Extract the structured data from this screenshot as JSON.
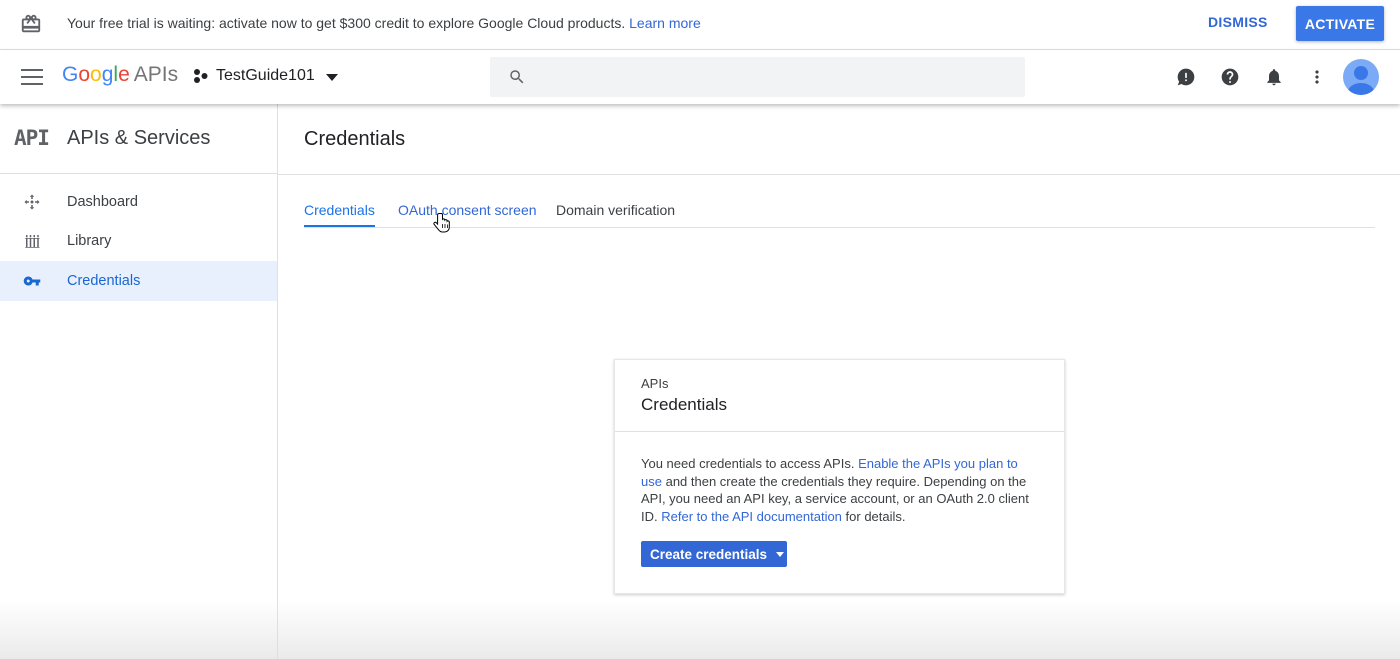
{
  "banner": {
    "message": "Your free trial is waiting: activate now to get $300 credit to explore Google Cloud products.",
    "learn_more": "Learn more",
    "dismiss": "DISMISS",
    "activate": "ACTIVATE",
    "icon": "gift-icon"
  },
  "appbar": {
    "logo_letters": [
      "G",
      "o",
      "o",
      "g",
      "l",
      "e"
    ],
    "logo_suffix": "APIs",
    "project_name": "TestGuide101",
    "search_placeholder": "",
    "icons": [
      "feedback-icon",
      "help-icon",
      "notifications-icon",
      "more-vert-icon"
    ]
  },
  "sidenav": {
    "mark": "API",
    "title": "APIs & Services",
    "items": [
      {
        "label": "Dashboard",
        "icon": "dashboard-icon",
        "active": false
      },
      {
        "label": "Library",
        "icon": "library-icon",
        "active": false
      },
      {
        "label": "Credentials",
        "icon": "key-icon",
        "active": true
      }
    ]
  },
  "main": {
    "title": "Credentials",
    "tabs": [
      {
        "label": "Credentials",
        "active": true
      },
      {
        "label": "OAuth consent screen",
        "active": false
      },
      {
        "label": "Domain verification",
        "active": false
      }
    ]
  },
  "card": {
    "eyebrow": "APIs",
    "title": "Credentials",
    "text_1": "You need credentials to access APIs.",
    "link_1": "Enable the APIs you plan to use",
    "text_2": "and then create the credentials they require. Depending on the API, you need an API key, a service account, or an OAuth 2.0 client ID.",
    "link_2": "Refer to the API documentation",
    "text_3": "for details.",
    "button": "Create credentials"
  },
  "colors": {
    "accent": "#3367d6",
    "active_bg": "#e8f0fe",
    "activate_bg": "#3b78e7"
  }
}
